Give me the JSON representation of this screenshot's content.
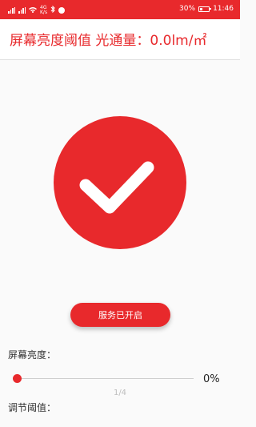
{
  "status_bar": {
    "network_label": "4G",
    "speed_label": "K/s",
    "battery_text": "30%",
    "time": "11:46"
  },
  "header": {
    "title": "屏幕亮度阈值 光通量：0.0lm/㎡"
  },
  "main": {
    "status_icon": "check-icon",
    "service_button_label": "服务已开启",
    "brightness_label": "屏幕亮度：",
    "slider_value": 0,
    "slider_percent_text": "0%",
    "page_indicator": "1/4",
    "threshold_label": "调节阈值："
  },
  "colors": {
    "accent": "#e8292c"
  }
}
